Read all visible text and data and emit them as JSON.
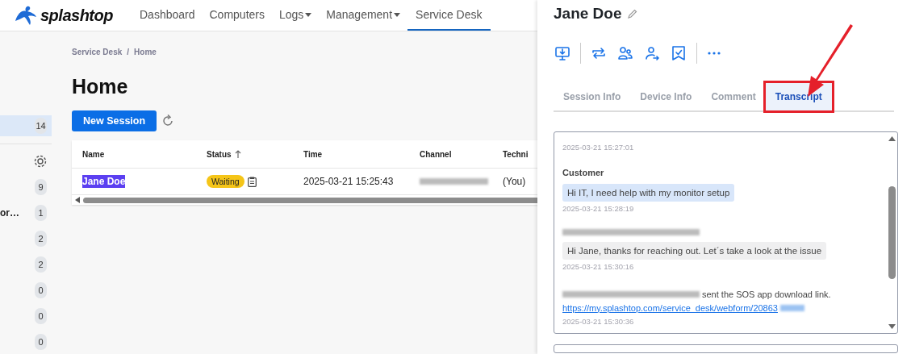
{
  "header": {
    "brand": "splashtop",
    "nav": [
      {
        "label": "Dashboard",
        "selected": false,
        "dropdown": false
      },
      {
        "label": "Computers",
        "selected": false,
        "dropdown": false
      },
      {
        "label": "Logs",
        "selected": false,
        "dropdown": true
      },
      {
        "label": "Management",
        "selected": false,
        "dropdown": true
      },
      {
        "label": "Service Desk",
        "selected": true,
        "dropdown": false
      }
    ]
  },
  "sidebar": {
    "items": [
      {
        "kind": "count",
        "count": "14",
        "selected": true
      },
      {
        "kind": "settings",
        "selected": false
      },
      {
        "kind": "count",
        "count": "9",
        "selected": false
      },
      {
        "kind": "count",
        "label": "or…",
        "count": "1",
        "selected": false
      },
      {
        "kind": "count",
        "count": "2",
        "selected": false
      },
      {
        "kind": "count",
        "count": "2",
        "selected": false
      },
      {
        "kind": "count",
        "count": "0",
        "selected": false
      },
      {
        "kind": "count",
        "count": "0",
        "selected": false
      },
      {
        "kind": "count",
        "count": "0",
        "selected": false
      }
    ]
  },
  "breadcrumb": {
    "items": [
      "Service Desk",
      "Home"
    ],
    "separator": "/"
  },
  "page_title": "Home",
  "new_session_button": "New Session",
  "table": {
    "columns": [
      {
        "label": "Name",
        "sorted": false
      },
      {
        "label": "Status",
        "sorted": true
      },
      {
        "label": "Time",
        "sorted": false
      },
      {
        "label": "Channel",
        "sorted": false
      },
      {
        "label": "Techni",
        "sorted": false
      }
    ],
    "rows": [
      {
        "name": "Jane Doe",
        "name_highlighted": true,
        "status": "Waiting",
        "time": "2025-03-21 15:25:43",
        "channel_redacted": true,
        "technician": "(You)"
      }
    ]
  },
  "panel": {
    "title": "Jane Doe",
    "actions": [
      {
        "kind": "download"
      },
      {
        "kind": "divider"
      },
      {
        "kind": "transfer"
      },
      {
        "kind": "users"
      },
      {
        "kind": "assign"
      },
      {
        "kind": "resolve"
      },
      {
        "kind": "divider"
      },
      {
        "kind": "more"
      }
    ],
    "tabs": [
      {
        "label": "Session Info",
        "selected": false,
        "outlined": false
      },
      {
        "label": "Device Info",
        "selected": false,
        "outlined": false
      },
      {
        "label": "Comment",
        "selected": false,
        "outlined": false
      },
      {
        "label": "Transcript",
        "selected": true,
        "outlined": true
      }
    ],
    "arrow_annotation": true,
    "transcript": [
      {
        "kind": "event",
        "timestamp": "2025-03-21 15:27:01"
      },
      {
        "kind": "customer",
        "sender": "Customer",
        "text": "Hi IT, I need help with my monitor setup",
        "timestamp": "2025-03-21 15:28:19"
      },
      {
        "kind": "agent",
        "sender_redacted": true,
        "text": "Hi Jane, thanks for reaching out. Let´s take a look at the issue",
        "timestamp": "2025-03-21 15:30:16"
      },
      {
        "kind": "notice",
        "sender_redacted": true,
        "text": "sent the SOS app download link.",
        "link": "https://my.splashtop.com/service_desk/webform/20863",
        "link_redacted": true,
        "timestamp": "2025-03-21 15:30:36"
      }
    ]
  }
}
